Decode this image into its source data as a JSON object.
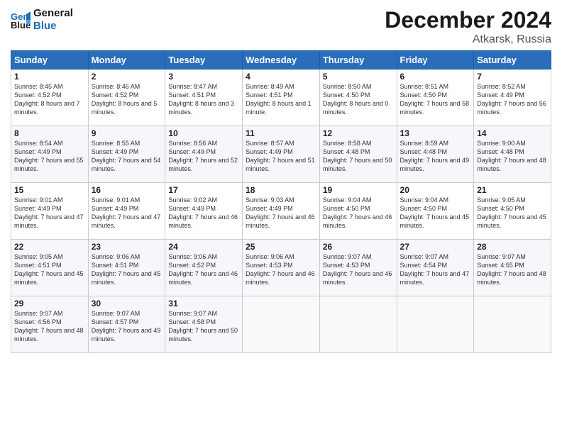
{
  "header": {
    "logo_line1": "General",
    "logo_line2": "Blue",
    "main_title": "December 2024",
    "subtitle": "Atkarsk, Russia"
  },
  "weekdays": [
    "Sunday",
    "Monday",
    "Tuesday",
    "Wednesday",
    "Thursday",
    "Friday",
    "Saturday"
  ],
  "weeks": [
    [
      {
        "day": 1,
        "sunrise": "8:45 AM",
        "sunset": "4:52 PM",
        "daylight": "8 hours and 7 minutes."
      },
      {
        "day": 2,
        "sunrise": "8:46 AM",
        "sunset": "4:52 PM",
        "daylight": "8 hours and 5 minutes."
      },
      {
        "day": 3,
        "sunrise": "8:47 AM",
        "sunset": "4:51 PM",
        "daylight": "8 hours and 3 minutes."
      },
      {
        "day": 4,
        "sunrise": "8:49 AM",
        "sunset": "4:51 PM",
        "daylight": "8 hours and 1 minute."
      },
      {
        "day": 5,
        "sunrise": "8:50 AM",
        "sunset": "4:50 PM",
        "daylight": "8 hours and 0 minutes."
      },
      {
        "day": 6,
        "sunrise": "8:51 AM",
        "sunset": "4:50 PM",
        "daylight": "7 hours and 58 minutes."
      },
      {
        "day": 7,
        "sunrise": "8:52 AM",
        "sunset": "4:49 PM",
        "daylight": "7 hours and 56 minutes."
      }
    ],
    [
      {
        "day": 8,
        "sunrise": "8:54 AM",
        "sunset": "4:49 PM",
        "daylight": "7 hours and 55 minutes."
      },
      {
        "day": 9,
        "sunrise": "8:55 AM",
        "sunset": "4:49 PM",
        "daylight": "7 hours and 54 minutes."
      },
      {
        "day": 10,
        "sunrise": "8:56 AM",
        "sunset": "4:49 PM",
        "daylight": "7 hours and 52 minutes."
      },
      {
        "day": 11,
        "sunrise": "8:57 AM",
        "sunset": "4:49 PM",
        "daylight": "7 hours and 51 minutes."
      },
      {
        "day": 12,
        "sunrise": "8:58 AM",
        "sunset": "4:48 PM",
        "daylight": "7 hours and 50 minutes."
      },
      {
        "day": 13,
        "sunrise": "8:59 AM",
        "sunset": "4:48 PM",
        "daylight": "7 hours and 49 minutes."
      },
      {
        "day": 14,
        "sunrise": "9:00 AM",
        "sunset": "4:48 PM",
        "daylight": "7 hours and 48 minutes."
      }
    ],
    [
      {
        "day": 15,
        "sunrise": "9:01 AM",
        "sunset": "4:49 PM",
        "daylight": "7 hours and 47 minutes."
      },
      {
        "day": 16,
        "sunrise": "9:01 AM",
        "sunset": "4:49 PM",
        "daylight": "7 hours and 47 minutes."
      },
      {
        "day": 17,
        "sunrise": "9:02 AM",
        "sunset": "4:49 PM",
        "daylight": "7 hours and 46 minutes."
      },
      {
        "day": 18,
        "sunrise": "9:03 AM",
        "sunset": "4:49 PM",
        "daylight": "7 hours and 46 minutes."
      },
      {
        "day": 19,
        "sunrise": "9:04 AM",
        "sunset": "4:50 PM",
        "daylight": "7 hours and 46 minutes."
      },
      {
        "day": 20,
        "sunrise": "9:04 AM",
        "sunset": "4:50 PM",
        "daylight": "7 hours and 45 minutes."
      },
      {
        "day": 21,
        "sunrise": "9:05 AM",
        "sunset": "4:50 PM",
        "daylight": "7 hours and 45 minutes."
      }
    ],
    [
      {
        "day": 22,
        "sunrise": "9:05 AM",
        "sunset": "4:51 PM",
        "daylight": "7 hours and 45 minutes."
      },
      {
        "day": 23,
        "sunrise": "9:06 AM",
        "sunset": "4:51 PM",
        "daylight": "7 hours and 45 minutes."
      },
      {
        "day": 24,
        "sunrise": "9:06 AM",
        "sunset": "4:52 PM",
        "daylight": "7 hours and 46 minutes."
      },
      {
        "day": 25,
        "sunrise": "9:06 AM",
        "sunset": "4:53 PM",
        "daylight": "7 hours and 46 minutes."
      },
      {
        "day": 26,
        "sunrise": "9:07 AM",
        "sunset": "4:53 PM",
        "daylight": "7 hours and 46 minutes."
      },
      {
        "day": 27,
        "sunrise": "9:07 AM",
        "sunset": "4:54 PM",
        "daylight": "7 hours and 47 minutes."
      },
      {
        "day": 28,
        "sunrise": "9:07 AM",
        "sunset": "4:55 PM",
        "daylight": "7 hours and 48 minutes."
      }
    ],
    [
      {
        "day": 29,
        "sunrise": "9:07 AM",
        "sunset": "4:56 PM",
        "daylight": "7 hours and 48 minutes."
      },
      {
        "day": 30,
        "sunrise": "9:07 AM",
        "sunset": "4:57 PM",
        "daylight": "7 hours and 49 minutes."
      },
      {
        "day": 31,
        "sunrise": "9:07 AM",
        "sunset": "4:58 PM",
        "daylight": "7 hours and 50 minutes."
      },
      null,
      null,
      null,
      null
    ]
  ],
  "labels": {
    "sunrise": "Sunrise:",
    "sunset": "Sunset:",
    "daylight": "Daylight:"
  }
}
